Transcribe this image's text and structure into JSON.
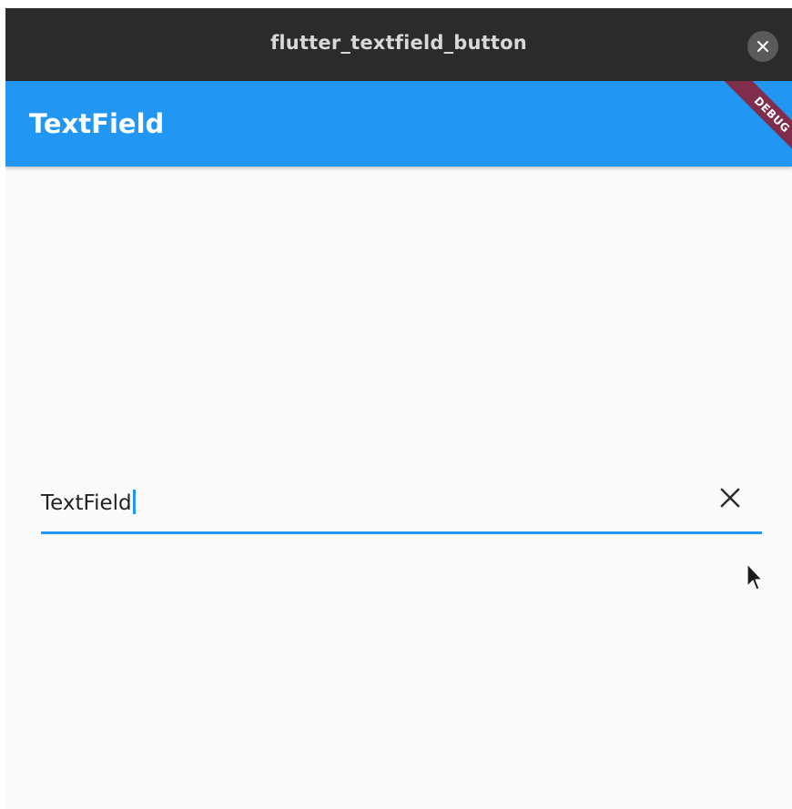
{
  "window": {
    "title": "flutter_textfield_button",
    "close_icon": "close-icon"
  },
  "appbar": {
    "title": "TextField",
    "color": "#2196f3"
  },
  "debug_banner": {
    "label": "DEBUG",
    "color": "#7f2d4a"
  },
  "textfield": {
    "value": "TextField",
    "clear_icon": "close-icon",
    "underline_color": "#2196f3"
  },
  "colors": {
    "titlebar": "#2b2b2b",
    "background": "#fafafa"
  }
}
